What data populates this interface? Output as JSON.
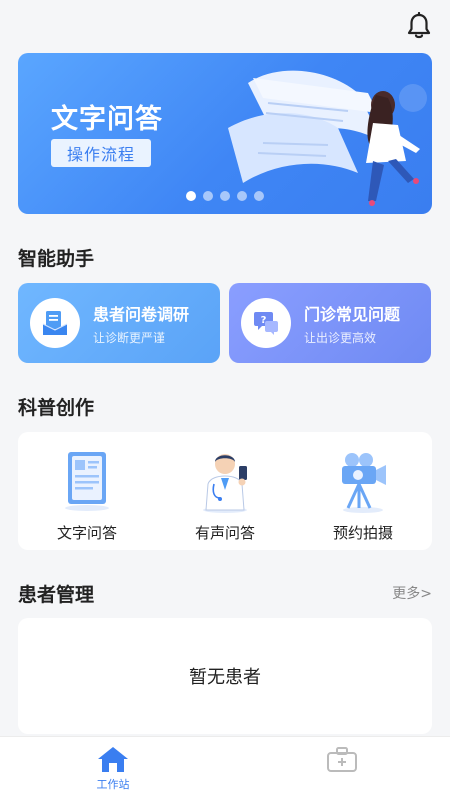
{
  "banner": {
    "title": "文字问答",
    "button_label": "操作流程",
    "slide_count": 5,
    "active_slide": 1
  },
  "assistant": {
    "section_title": "智能助手",
    "cards": [
      {
        "title": "患者问卷调研",
        "subtitle": "让诊断更严谨",
        "icon": "questionnaire-icon"
      },
      {
        "title": "门诊常见问题",
        "subtitle": "让出诊更高效",
        "icon": "faq-chat-icon"
      }
    ]
  },
  "creation": {
    "section_title": "科普创作",
    "items": [
      {
        "label": "文字问答",
        "icon": "document-icon"
      },
      {
        "label": "有声问答",
        "icon": "doctor-phone-icon"
      },
      {
        "label": "预约拍摄",
        "icon": "video-camera-icon"
      }
    ]
  },
  "patients": {
    "section_title": "患者管理",
    "more_label": "更多>",
    "empty_text": "暂无患者"
  },
  "tabbar": {
    "items": [
      {
        "label": "工作站",
        "icon": "home-icon",
        "active": true
      },
      {
        "label": "",
        "icon": "medical-bag-icon",
        "active": false
      }
    ]
  },
  "colors": {
    "accent": "#3a7ef0",
    "background": "#f5f6f8"
  }
}
